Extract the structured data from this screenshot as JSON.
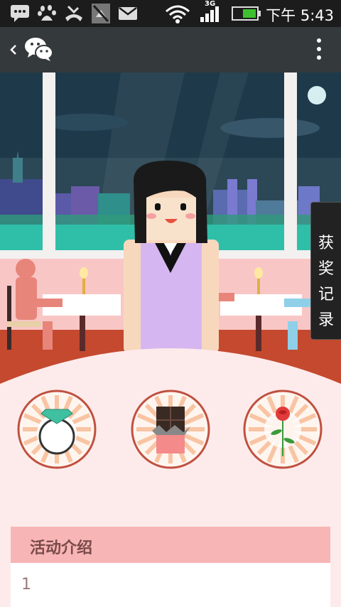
{
  "status_bar": {
    "time": "下午 5:43",
    "network": "3G",
    "notification_icons": [
      "sms-icon",
      "baidu-paw-icon",
      "missed-call-icon",
      "mute-icon",
      "mail-icon"
    ],
    "battery_color": "#3fbf2f"
  },
  "titlebar": {
    "back_icon": "chevron-left-icon",
    "app_icon": "wechat-logo-icon",
    "menu_icon": "more-vertical-icon"
  },
  "award_tab": {
    "chars": [
      "获",
      "奖",
      "记",
      "录"
    ]
  },
  "prizes": [
    {
      "name": "ring-prize",
      "icon": "diamond-ring-icon"
    },
    {
      "name": "chocolate-prize",
      "icon": "chocolate-bar-icon"
    },
    {
      "name": "rose-prize",
      "icon": "rose-icon"
    }
  ],
  "intro": {
    "heading": "活动介绍",
    "body": "1"
  },
  "colors": {
    "accent_pink": "#f8b5b5",
    "panel_bg": "#fbeaea",
    "titlebar": "#34393c",
    "prize_ring": "#c0503f"
  }
}
